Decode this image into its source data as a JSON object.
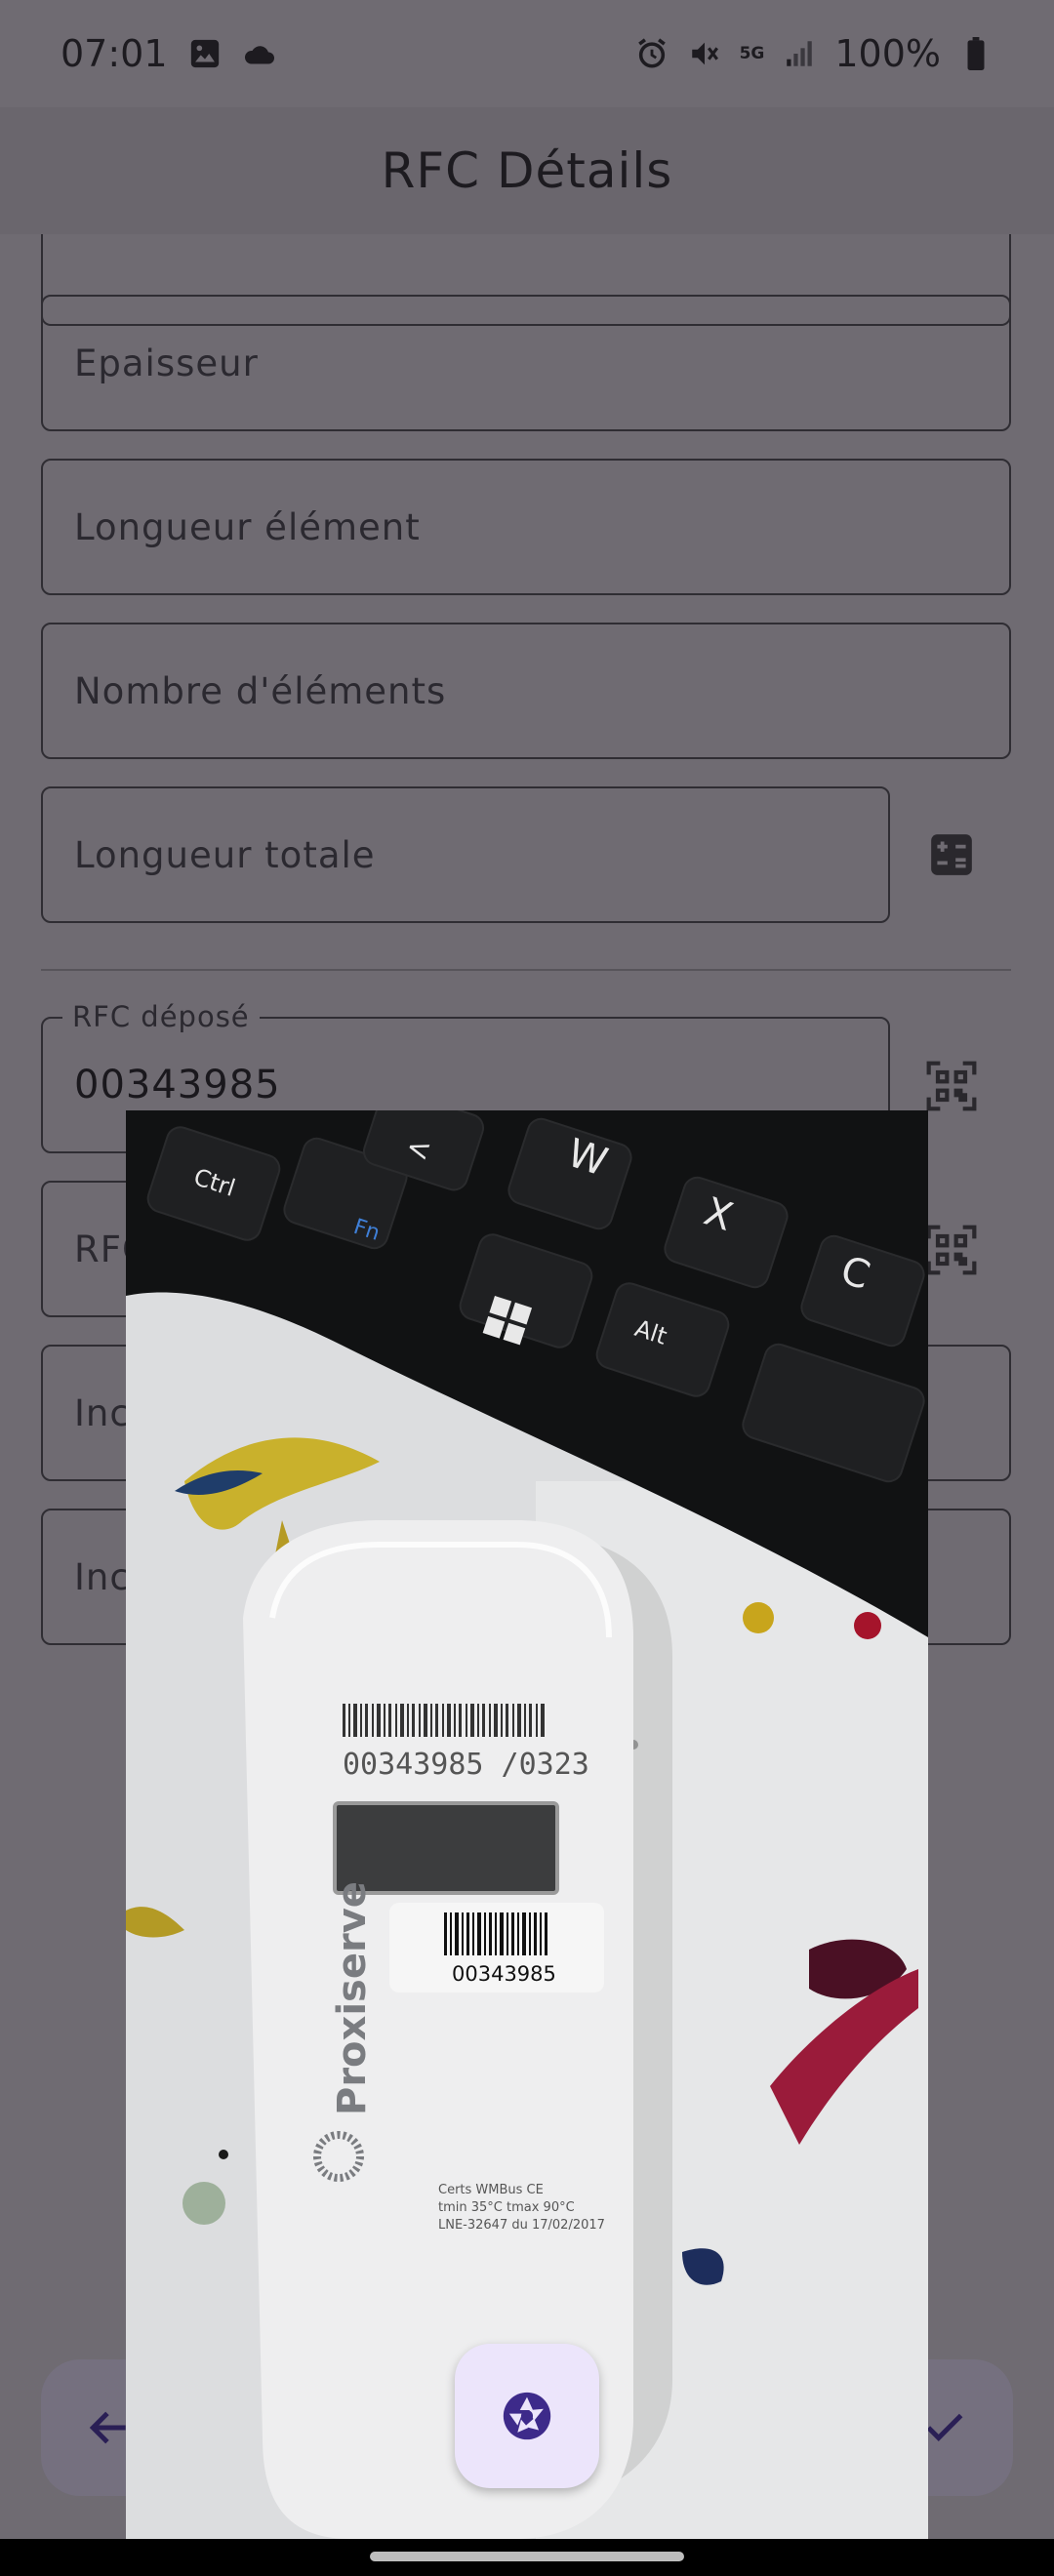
{
  "status_bar": {
    "time": "07:01",
    "battery": "100%",
    "network": "5G",
    "icons": [
      "gallery-icon",
      "cloud-icon",
      "alarm-icon",
      "mute-icon",
      "signal-icon",
      "battery-icon"
    ]
  },
  "app_bar": {
    "title": "RFC Détails"
  },
  "form": {
    "epaisseur": "Epaisseur",
    "longueur_element": "Longueur élément",
    "nombre_elements": "Nombre d'éléments",
    "longueur_totale": "Longueur totale",
    "rfc_depose_label": "RFC déposé",
    "rfc_depose_value": "00343985",
    "rfc_partial": "RFC",
    "ind_1_partial": "Inc",
    "ind_2_partial": "Inc"
  },
  "camera_preview": {
    "keyboard_keys": [
      "Ctrl",
      "Fn",
      "Alt",
      "W",
      "X",
      "C",
      "<"
    ],
    "device_barcode_number": "00343985 /0323",
    "device_label_number": "00343985",
    "device_brand": "Proxiserve",
    "device_fineprint": [
      "Certs WMBus CE",
      "tmin 35°C tmax 90°C",
      "LNE-32647 du 17/02/2017"
    ]
  },
  "colors": {
    "scrim": "#6f6b72",
    "shutter_bg": "#ece5fb",
    "accent": "#4a2f9a"
  }
}
